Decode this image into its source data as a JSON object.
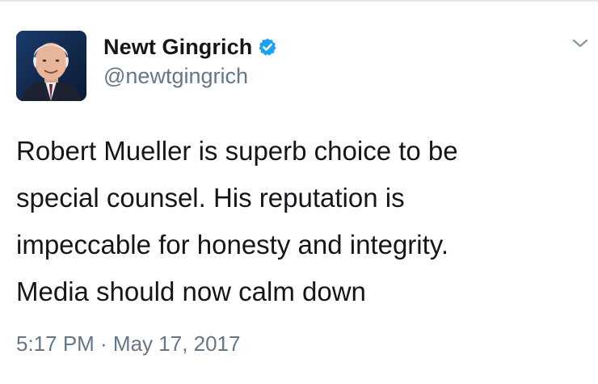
{
  "tweet": {
    "author": {
      "display_name": "Newt Gingrich",
      "handle": "@newtgingrich",
      "verified": true,
      "avatar_icon": "profile-photo"
    },
    "text": "Robert Mueller is superb choice to be\nspecial counsel. His reputation is\nimpeccable for honesty and integrity.\nMedia should now calm down",
    "timestamp": "5:17 PM · May 17, 2017",
    "menu_icon": "chevron-down-icon"
  },
  "colors": {
    "text": "#14171a",
    "secondary": "#657786",
    "verified": "#1da1f2",
    "border": "#e1e8ed"
  }
}
